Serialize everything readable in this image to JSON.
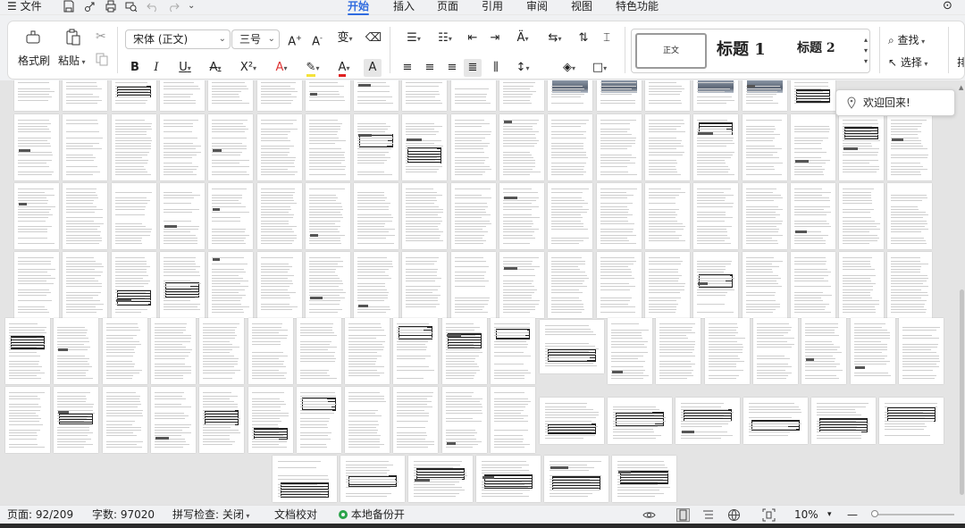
{
  "menubar": {
    "file_label": "文件",
    "tabs": [
      {
        "label": "开始",
        "active": true
      },
      {
        "label": "插入",
        "active": false
      },
      {
        "label": "页面",
        "active": false
      },
      {
        "label": "引用",
        "active": false
      },
      {
        "label": "审阅",
        "active": false
      },
      {
        "label": "视图",
        "active": false
      },
      {
        "label": "特色功能",
        "active": false
      }
    ]
  },
  "ribbon": {
    "format_painter": "格式刷",
    "paste": "粘贴",
    "font_name": "宋体 (正文)",
    "font_size": "三号",
    "style_normal": "正文",
    "style_h1": "标题 1",
    "style_h2": "标题 2",
    "find": "查找",
    "select": "选择",
    "cut_off_label": "排"
  },
  "tooltip": {
    "welcome": "欢迎回来!"
  },
  "statusbar": {
    "page": "页面: 92/209",
    "words": "字数: 97020",
    "spellcheck": "拼写检查: 关闭",
    "proofread": "文档校对",
    "backup": "本地备份开",
    "zoom": "10%"
  },
  "colors": {
    "accent": "#2f6bdf",
    "font_color": "#e02020",
    "highlight": "#f5e23a",
    "backup_ok": "#2aa34a"
  }
}
